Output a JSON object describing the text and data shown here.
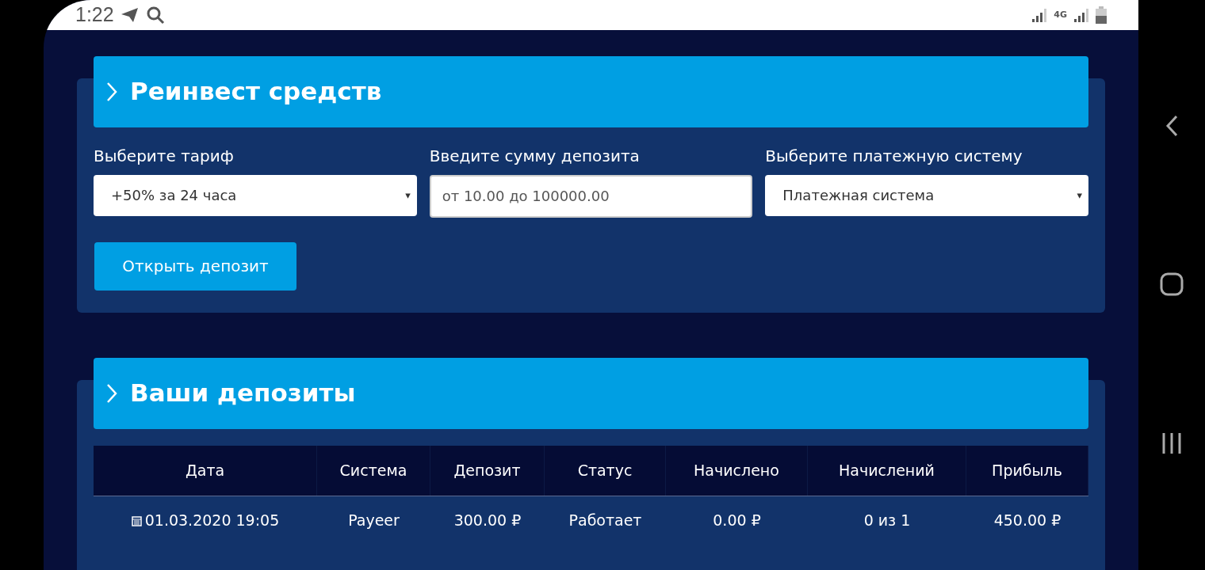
{
  "status_bar": {
    "time": "1:22",
    "network": "4G"
  },
  "reinvest": {
    "title": "Реинвест средств",
    "fields": [
      {
        "kind": "select",
        "label": "Выберите тариф",
        "value": "+50% за 24 часа"
      },
      {
        "kind": "input",
        "label": "Введите сумму депозита",
        "placeholder": "от 10.00 до 100000.00"
      },
      {
        "kind": "select",
        "label": "Выберите платежную систему",
        "value": "Платежная система"
      }
    ],
    "button": "Открыть депозит",
    "select_caret": "▾"
  },
  "deposits": {
    "title": "Ваши депозиты",
    "table": {
      "columns": [
        "Дата",
        "Система",
        "Депозит",
        "Статус",
        "Начислено",
        "Начислений",
        "Прибыль"
      ],
      "rows": [
        [
          "01.03.2020 19:05",
          "Payeer",
          "300.00 ₽",
          "Работает",
          "0.00 ₽",
          "0 из 1",
          "450.00 ₽"
        ]
      ]
    }
  }
}
